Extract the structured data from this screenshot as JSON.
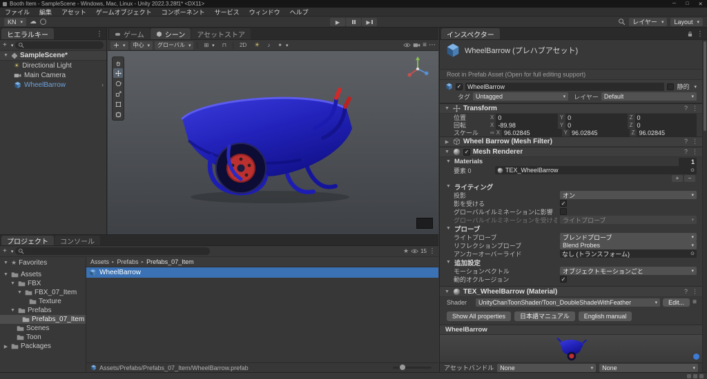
{
  "window": {
    "title": "Booth Item - SampleScene - Windows, Mac, Linux - Unity 2022.3.28f1* <DX11>",
    "minimize": "─",
    "maximize": "□",
    "close": "✕"
  },
  "menu": {
    "items": [
      "ファイル",
      "編集",
      "アセット",
      "ゲームオブジェクト",
      "コンポーネント",
      "サービス",
      "ウィンドウ",
      "ヘルプ"
    ]
  },
  "toolbar": {
    "account": "KN",
    "layers": "レイヤー",
    "layout": "Layout"
  },
  "hierarchy": {
    "tab": "ヒエラルキー",
    "scene_name": "SampleScene*",
    "items": [
      {
        "label": "Directional Light"
      },
      {
        "label": "Main Camera"
      },
      {
        "label": "WheelBarrow"
      }
    ]
  },
  "scene": {
    "tabs": {
      "game": "ゲーム",
      "scene": "シーン",
      "asset_store": "アセットストア"
    },
    "toolbar": {
      "pivot": "中心",
      "orientation": "グローバル",
      "mode_2d": "2D"
    }
  },
  "inspector": {
    "tab": "インスペクター",
    "prefab_header": "WheelBarrow (プレハブアセット)",
    "root_note": "Root in Prefab Asset (Open for full editing support)",
    "game_object": {
      "name": "WheelBarrow",
      "static_label": "静的",
      "tag_label": "タグ",
      "tag_value": "Untagged",
      "layer_label": "レイヤー",
      "layer_value": "Default"
    },
    "transform": {
      "title": "Transform",
      "axes": [
        "X",
        "Y",
        "Z"
      ],
      "rows": [
        {
          "label": "位置",
          "x": "0",
          "y": "0",
          "z": "0"
        },
        {
          "label": "回転",
          "x": "-89.98",
          "y": "0",
          "z": "0"
        },
        {
          "label": "スケール",
          "x": "96.02845",
          "y": "96.02845",
          "z": "96.02845"
        }
      ]
    },
    "mesh_filter": {
      "title": "Wheel Barrow (Mesh Filter)"
    },
    "mesh_renderer": {
      "title": "Mesh Renderer",
      "materials": {
        "title": "Materials",
        "count": "1",
        "element_label": "要素 0",
        "element_value": "TEX_WheelBarrow"
      },
      "lighting": {
        "title": "ライティング",
        "cast_shadows_label": "投影",
        "cast_shadows_value": "オン",
        "receive_shadows_label": "影を受ける",
        "gi_contribute_label": "グローバルイルミネーションに影響",
        "gi_receive_label": "グローバルイルミネーションを受ける",
        "gi_receive_value": "ライトプローブ"
      },
      "probes": {
        "title": "プローブ",
        "light_probes_label": "ライトプローブ",
        "light_probes_value": "ブレンドプローブ",
        "reflection_probes_label": "リフレクションプローブ",
        "reflection_probes_value": "Blend Probes",
        "anchor_label": "アンカーオーバーライド",
        "anchor_value": "なし (トランスフォーム)"
      },
      "additional": {
        "title": "追加設定",
        "motion_vectors_label": "モーションベクトル",
        "motion_vectors_value": "オブジェクトモーションごと",
        "occlusion_label": "動的オクルージョン"
      }
    },
    "material": {
      "title": "TEX_WheelBarrow (Material)",
      "shader_label": "Shader",
      "shader_value": "UnityChanToonShader/Toon_DoubleShadeWithFeather",
      "edit_button": "Edit...",
      "buttons": [
        "Show All properties",
        "日本語マニュアル",
        "English manual"
      ]
    },
    "preview": {
      "title": "WheelBarrow"
    },
    "asset_bundle": {
      "label": "アセットバンドル",
      "bundle": "None",
      "variant": "None"
    }
  },
  "project": {
    "tab": "プロジェクト",
    "console_tab": "コンソール",
    "hidden_count": "15",
    "favorites_label": "Favorites",
    "tree": {
      "assets": "Assets",
      "fbx": "FBX",
      "fbx_item": "FBX_07_Item",
      "texture": "Texture",
      "prefabs": "Prefabs",
      "prefabs_item": "Prefabs_07_Item",
      "scenes": "Scenes",
      "toon": "Toon",
      "packages": "Packages"
    },
    "breadcrumb": [
      "Assets",
      "Prefabs",
      "Prefabs_07_Item"
    ],
    "selected_item": "WheelBarrow",
    "path": "Assets/Prefabs/Prefabs_07_Item/WheelBarrow.prefab"
  },
  "icons": {
    "caret": "▾",
    "foldout_open": "▼",
    "foldout_closed": "▶",
    "check": "✓",
    "dots": "⋮",
    "ellipsis": "⋯",
    "plus": "+",
    "minus": "−",
    "chevron_right": "›",
    "crumb_sep": "▸",
    "help": "?",
    "picker": "⊙",
    "link": "∞",
    "star": "★",
    "cloud": "☁",
    "menu": "≡",
    "grid": "⊞",
    "snap": "⊓",
    "light": "☀",
    "audio": "♪",
    "effects": "✦",
    "play": "▶"
  }
}
